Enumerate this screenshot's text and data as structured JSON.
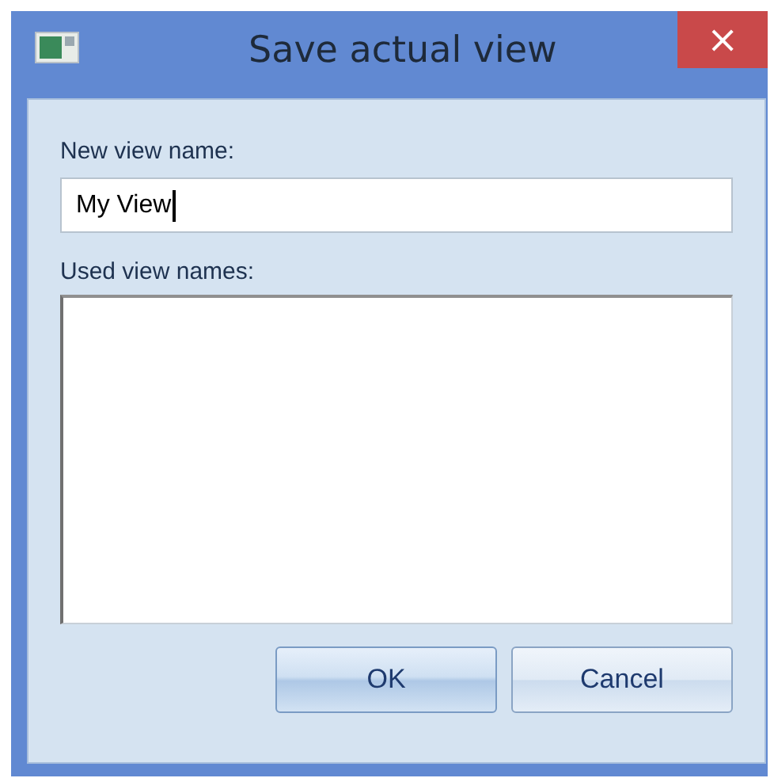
{
  "window": {
    "title": "Save actual view",
    "close": "×"
  },
  "new_name": {
    "label": "New view name:",
    "value": "My View"
  },
  "used_names": {
    "label": "Used view names:"
  },
  "buttons": [
    {
      "label": "OK",
      "default": true
    },
    {
      "label": "Cancel",
      "default": false
    }
  ]
}
